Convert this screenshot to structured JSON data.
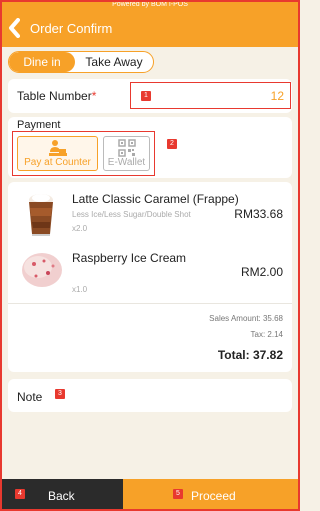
{
  "header": {
    "powered_by": "Powered by BOM I-POS",
    "title": "Order Confirm"
  },
  "order_type": {
    "options": [
      "Dine in",
      "Take Away"
    ],
    "selected": "Dine in"
  },
  "table": {
    "label": "Table Number",
    "required_mark": "*",
    "value": "12"
  },
  "payment": {
    "label": "Payment",
    "options": [
      {
        "label": "Pay at Counter",
        "icon": "cashier-icon",
        "selected": true
      },
      {
        "label": "E-Wallet",
        "icon": "qr-code-icon",
        "selected": false
      }
    ]
  },
  "items": [
    {
      "name": "Latte Classic Caramel (Frappe)",
      "modifiers": "Less Ice/Less Sugar/Double Shot",
      "qty": "x2.0",
      "price": "RM33.68",
      "image": "caramel-frappe-image"
    },
    {
      "name": "Raspberry  Ice Cream",
      "modifiers": "",
      "qty": "x1.0",
      "price": "RM2.00",
      "image": "raspberry-ice-cream-image"
    }
  ],
  "summary": {
    "sales_amount": "Sales Amount: 35.68",
    "tax": "Tax: 2.14",
    "total": "Total: 37.82"
  },
  "note": {
    "label": "Note"
  },
  "annotations": [
    "1",
    "2",
    "3",
    "4",
    "5"
  ],
  "footer": {
    "back_label": "Back",
    "proceed_label": "Proceed"
  },
  "colors": {
    "accent": "#f7a128",
    "highlight": "#e8392f",
    "background": "#f6f1e6",
    "dark_button": "#2b2b2b"
  }
}
